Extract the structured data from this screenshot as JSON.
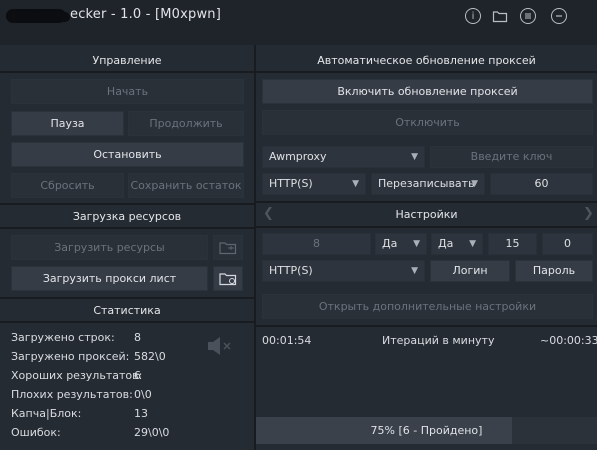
{
  "window": {
    "title": "ecker - 1.0 - [M0xpwn]"
  },
  "left": {
    "control": {
      "title": "Управление",
      "start": "Начать",
      "pause": "Пауза",
      "resume": "Продолжить",
      "stop": "Остановить",
      "reset": "Сбросить",
      "save_rest": "Сохранить остаток"
    },
    "resources": {
      "title": "Загрузка ресурсов",
      "load_resources": "Загрузить ресурсы",
      "load_proxy": "Загрузить прокси лист"
    },
    "stats": {
      "title": "Статистика",
      "rows": [
        {
          "label": "Загружено строк:",
          "value": "8"
        },
        {
          "label": "Загружено проксей:",
          "value": "582\\0"
        },
        {
          "label": "Хороших результатов:",
          "value": "6"
        },
        {
          "label": "Плохих результатов:",
          "value": "0\\0"
        },
        {
          "label": "Капча|Блок:",
          "value": "13"
        },
        {
          "label": "Ошибок:",
          "value": "29\\0\\0"
        }
      ]
    }
  },
  "right": {
    "autoupdate": {
      "title": "Автоматическое обновление проксей",
      "enable": "Включить обновление проксей",
      "disable": "Отключить",
      "provider": "Awmproxy",
      "key_placeholder": "Введите ключ",
      "protocol": "HTTP(S)",
      "mode": "Перезаписывать",
      "interval": "60"
    },
    "settings": {
      "title": "Настройки",
      "threads": "8",
      "opt1": "Да",
      "opt2": "Да",
      "num1": "15",
      "num2": "0",
      "proxy_type": "HTTP(S)",
      "login": "Логин",
      "password": "Пароль",
      "more": "Открыть дополнительные настройки"
    },
    "timing": {
      "elapsed": "00:01:54",
      "rate_label": "Итераций в минуту",
      "remaining": "~00:00:33"
    }
  },
  "progress": {
    "text": "75% [6 - Пройдено]",
    "fraction": 0.75
  }
}
